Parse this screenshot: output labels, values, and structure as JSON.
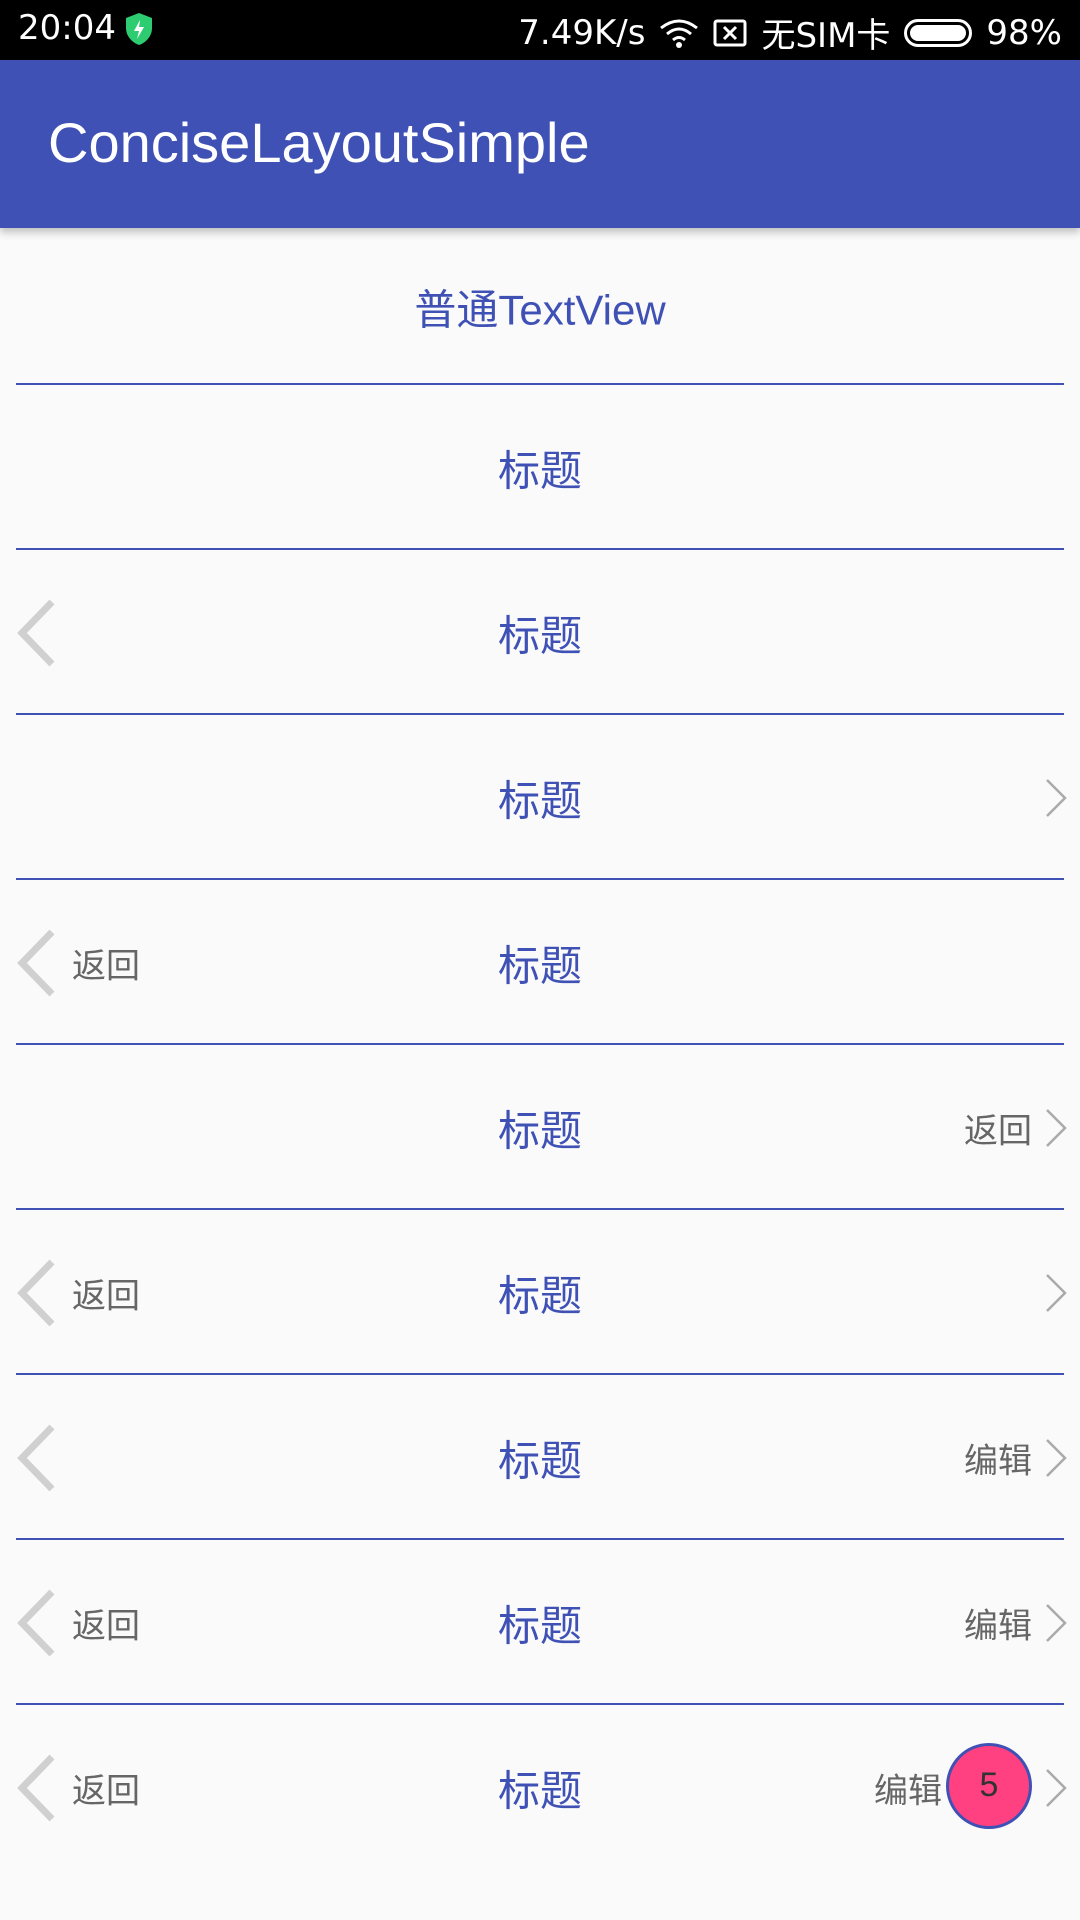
{
  "status_bar": {
    "time": "20:04",
    "net_speed": "7.49K/s",
    "sim": "无SIM卡",
    "battery": "98%",
    "icons": [
      "shield-icon",
      "wifi-icon",
      "sim-x-icon",
      "battery-icon"
    ]
  },
  "app_bar": {
    "title": "ConciseLayoutSimple",
    "color": "#3f51b5"
  },
  "rows": [
    {
      "title": "普通TextView"
    },
    {
      "title": "标题"
    },
    {
      "title": "标题"
    },
    {
      "title": "标题"
    },
    {
      "title": "标题",
      "left_text": "返回"
    },
    {
      "title": "标题",
      "right_text": "返回"
    },
    {
      "title": "标题",
      "left_text": "返回"
    },
    {
      "title": "标题",
      "right_text": "编辑"
    },
    {
      "title": "标题",
      "left_text": "返回",
      "right_text": "编辑"
    },
    {
      "title": "标题",
      "left_text": "返回",
      "right_text": "编辑",
      "badge": "5"
    }
  ],
  "colors": {
    "accent": "#3f51b5",
    "badge": "#ff4081",
    "secondary_text": "#666666",
    "arrow": "#d0d0d0"
  }
}
